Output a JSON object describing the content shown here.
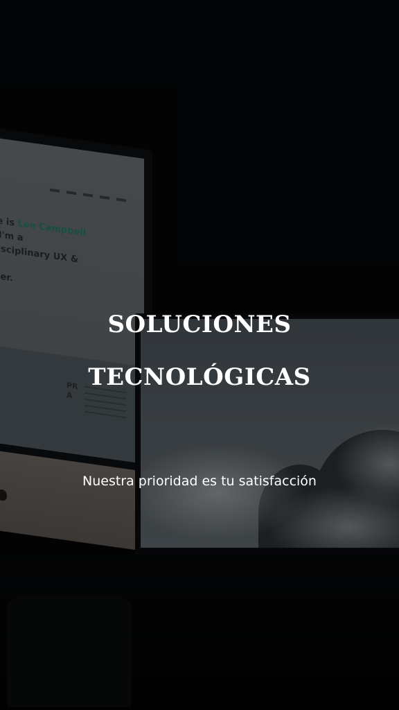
{
  "hero": {
    "title_line_1": "SOLUCIONES",
    "title_line_2": "TECNOLÓGICAS",
    "subtitle": "Nuestra prioridad es tu satisfacción"
  },
  "background_screen_text": {
    "line_1_prefix": "me is ",
    "line_1_accent": "Lee Campbell",
    "line_1_suffix": " & I'm a",
    "line_2": "-disciplinary UX & UI",
    "line_3": "gner.",
    "panel_label": "PR A"
  },
  "colors": {
    "text": "#ffffff",
    "background": "#050607",
    "screen_accent": "#1a7a63"
  }
}
